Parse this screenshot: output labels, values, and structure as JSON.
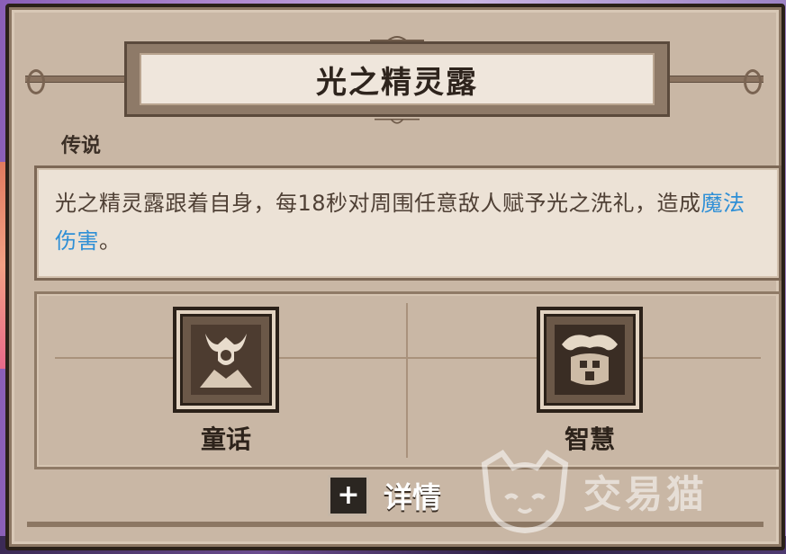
{
  "item": {
    "title": "光之精灵露",
    "rarity": "传说",
    "description_plain": "光之精灵露跟着自身，每18秒对周围任意敌人赋予光之洗礼，造成",
    "description_highlight": "魔法伤害",
    "description_end": "。",
    "highlight_color": "#2e8fd6"
  },
  "traits": [
    {
      "label": "童话",
      "icon": "fairy-tale-emblem-icon"
    },
    {
      "label": "智慧",
      "icon": "wisdom-emblem-icon"
    }
  ],
  "footer": {
    "detail_icon": "+",
    "detail_label": "详情"
  },
  "watermark": {
    "text": "交易猫",
    "icon": "cat-face-icon"
  }
}
